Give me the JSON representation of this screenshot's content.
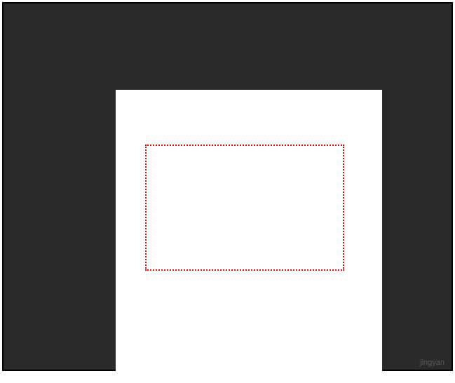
{
  "canvas": {
    "selection": {
      "border_color": "#ff0000",
      "border_style": "dotted"
    }
  },
  "watermark": {
    "text": "jingyan"
  }
}
